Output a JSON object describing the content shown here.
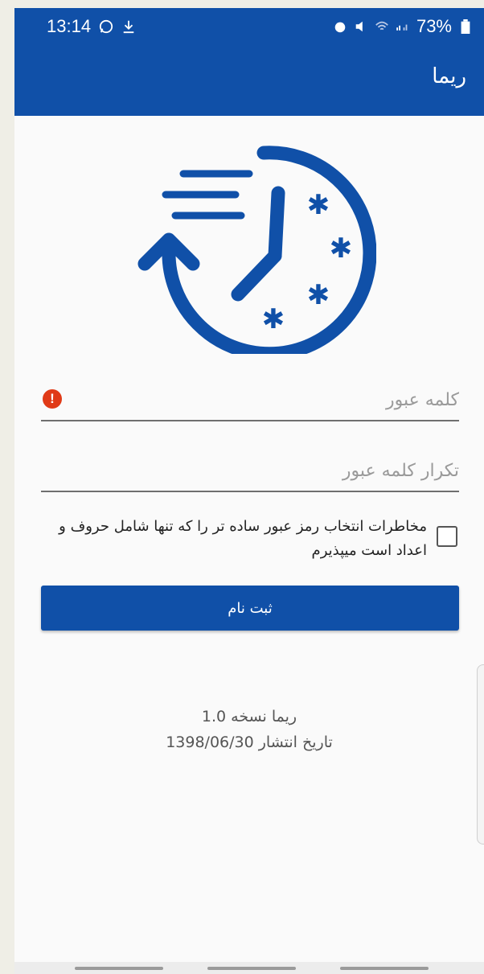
{
  "status_bar": {
    "time": "13:14",
    "battery": "73%",
    "left_icons": [
      "whatsapp-icon",
      "download-icon"
    ],
    "right_icons": [
      "alarm-icon",
      "mute-icon",
      "wifi-icon",
      "signal-icon",
      "battery-icon"
    ]
  },
  "app_bar": {
    "title": "ریما"
  },
  "logo": {
    "icon": "clock-history-icon",
    "color": "#1050a8"
  },
  "password": {
    "placeholder": "کلمه عبور",
    "value": "",
    "error_icon": "error-icon"
  },
  "confirm_password": {
    "placeholder": "تکرار کلمه عبور",
    "value": ""
  },
  "risk_checkbox": {
    "label": "مخاطرات انتخاب رمز عبور ساده تر را که تنها شامل حروف و اعداد است میپذیرم",
    "checked": false
  },
  "register_button": {
    "label": "ثبت نام"
  },
  "footer": {
    "version": "ریما نسخه 1.0",
    "release_date": "تاریخ انتشار 1398/06/30"
  },
  "colors": {
    "primary": "#1050a8",
    "error": "#e03a17",
    "background": "#fafafa"
  }
}
